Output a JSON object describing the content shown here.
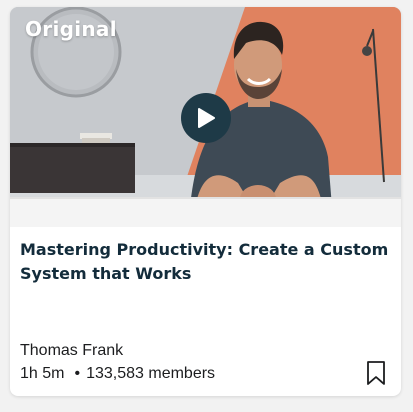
{
  "card": {
    "badge": "Original",
    "title": "Mastering Productivity: Create a Custom System that Works",
    "instructor": "Thomas Frank",
    "duration": "1h 5m",
    "separator": "•",
    "members": "133,583 members",
    "icons": {
      "play": "play-icon",
      "bookmark": "bookmark-icon"
    },
    "colors": {
      "play_button": "#1e3a47",
      "title_text": "#132c3b",
      "accent_wall": "#e08060"
    }
  }
}
